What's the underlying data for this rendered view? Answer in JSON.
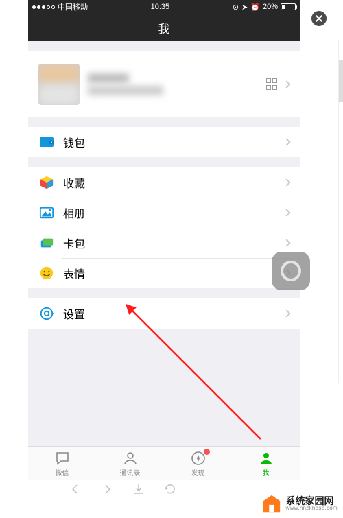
{
  "status": {
    "carrier": "中国移动",
    "time": "10:35",
    "battery_pct": "20%"
  },
  "nav": {
    "title": "我"
  },
  "menu": {
    "wallet": "钱包",
    "favorites": "收藏",
    "album": "相册",
    "cards": "卡包",
    "stickers": "表情",
    "settings": "设置"
  },
  "tabs": {
    "chats": "微信",
    "contacts": "通讯录",
    "discover": "发现",
    "me": "我"
  },
  "watermark": {
    "cn": "系统家园网",
    "en": "www.hnzkhbsb.com"
  }
}
